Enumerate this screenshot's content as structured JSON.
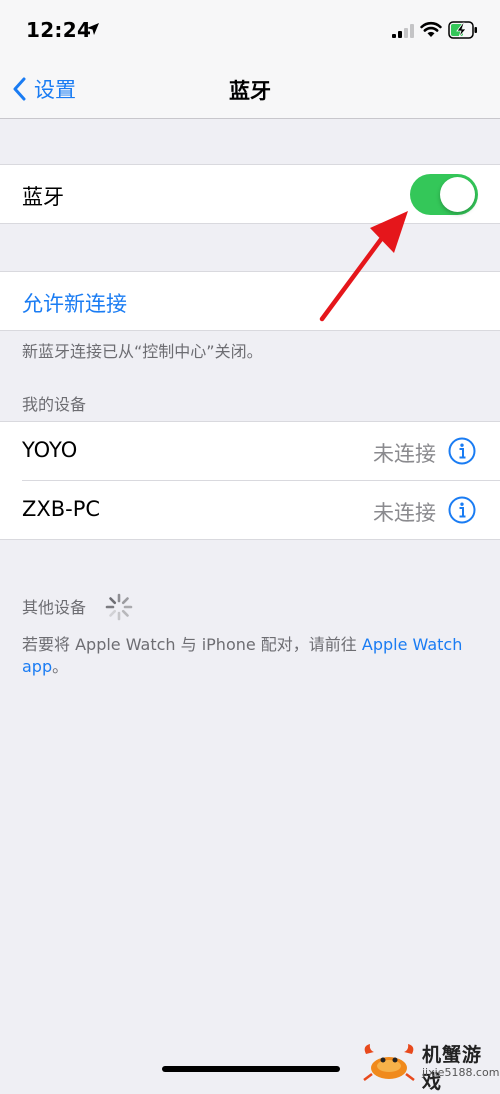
{
  "status_bar": {
    "time": "12:24"
  },
  "nav": {
    "back_label": "设置",
    "title": "蓝牙"
  },
  "bluetooth": {
    "label": "蓝牙",
    "enabled": true,
    "toggle_color": "#34c759"
  },
  "allow_new": {
    "label": "允许新连接",
    "note": "新蓝牙连接已从“控制中心”关闭。"
  },
  "my_devices": {
    "header": "我的设备",
    "items": [
      {
        "name": "YOYO",
        "status": "未连接"
      },
      {
        "name": "ZXB-PC",
        "status": "未连接"
      }
    ]
  },
  "other_devices": {
    "header": "其他设备",
    "note_prefix": "若要将 Apple Watch 与 iPhone 配对，请前往",
    "note_link": "Apple Watch",
    "note_link_wrap": "app",
    "note_suffix": "。"
  },
  "accent_color": "#1a7cf3",
  "watermark": {
    "name": "机蟹游戏",
    "url": "jixie5188.com"
  }
}
